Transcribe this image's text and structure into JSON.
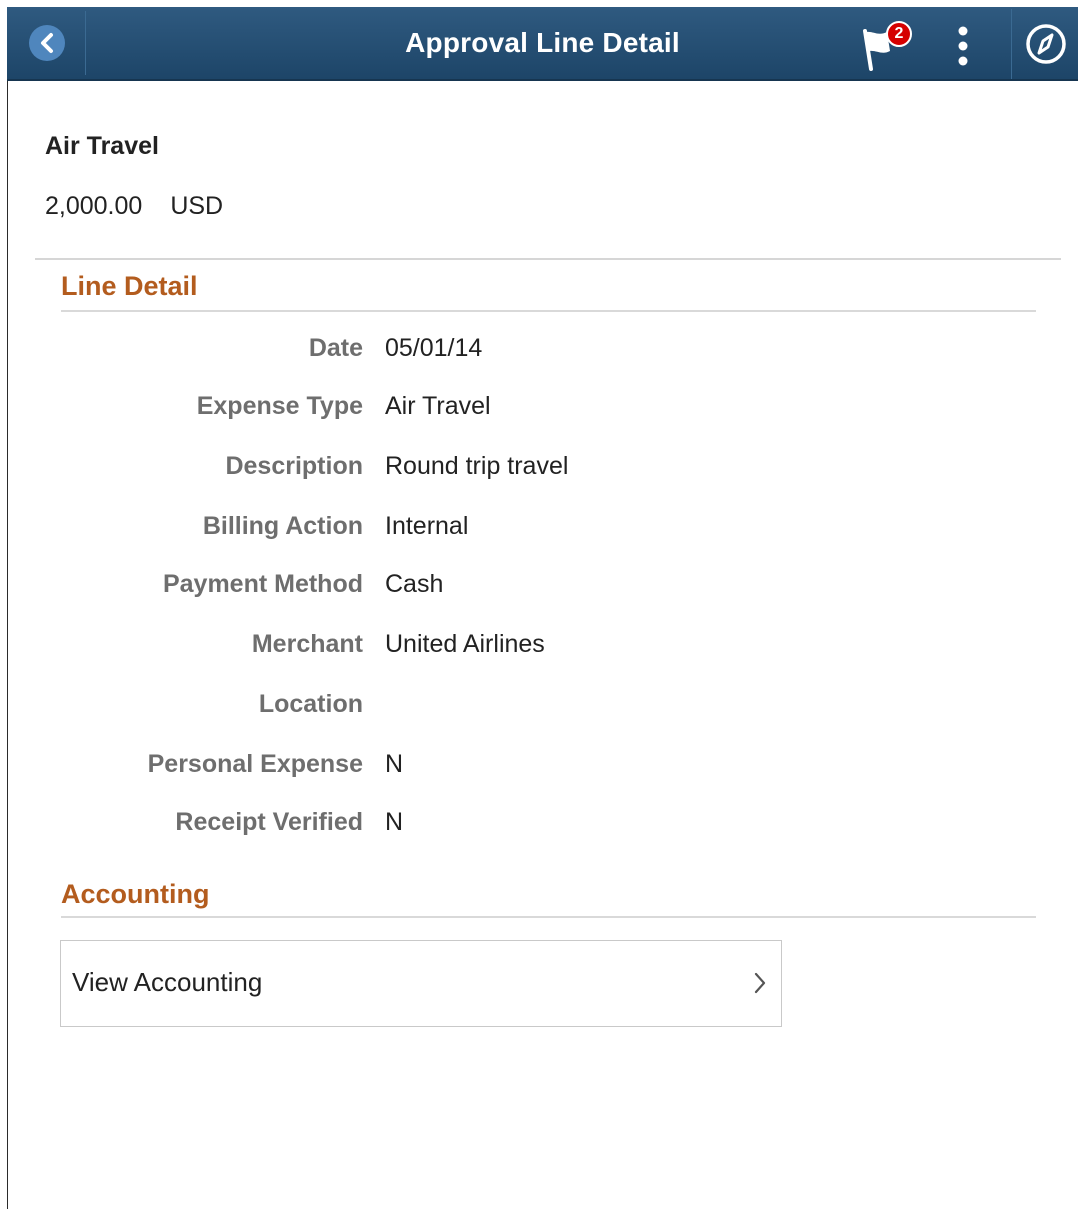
{
  "header": {
    "title": "Approval Line Detail",
    "notification_count": "2",
    "icons": {
      "back": "chevron-left-icon",
      "notifications": "flag-icon",
      "menu": "kebab-menu-icon",
      "navigation": "compass-icon"
    },
    "colors": {
      "bar": "#1d4568",
      "back_circle": "#4f86bd",
      "badge": "#d50000"
    }
  },
  "summary": {
    "title": "Air Travel",
    "amount": "2,000.00",
    "currency": "USD"
  },
  "line_detail": {
    "heading": "Line Detail",
    "fields": [
      {
        "label": "Date",
        "value": "05/01/14"
      },
      {
        "label": "Expense Type",
        "value": "Air Travel"
      },
      {
        "label": "Description",
        "value": "Round trip travel"
      },
      {
        "label": "Billing Action",
        "value": "Internal"
      },
      {
        "label": "Payment Method",
        "value": "Cash"
      },
      {
        "label": "Merchant",
        "value": "United Airlines"
      },
      {
        "label": "Location",
        "value": ""
      },
      {
        "label": "Personal Expense",
        "value": "N"
      },
      {
        "label": "Receipt Verified",
        "value": "N"
      }
    ]
  },
  "accounting": {
    "heading": "Accounting",
    "view_label": "View Accounting",
    "chevron_icon": "chevron-right-icon"
  },
  "theme": {
    "section_heading_color": "#b35c1e",
    "label_color": "#6e6e6e"
  }
}
